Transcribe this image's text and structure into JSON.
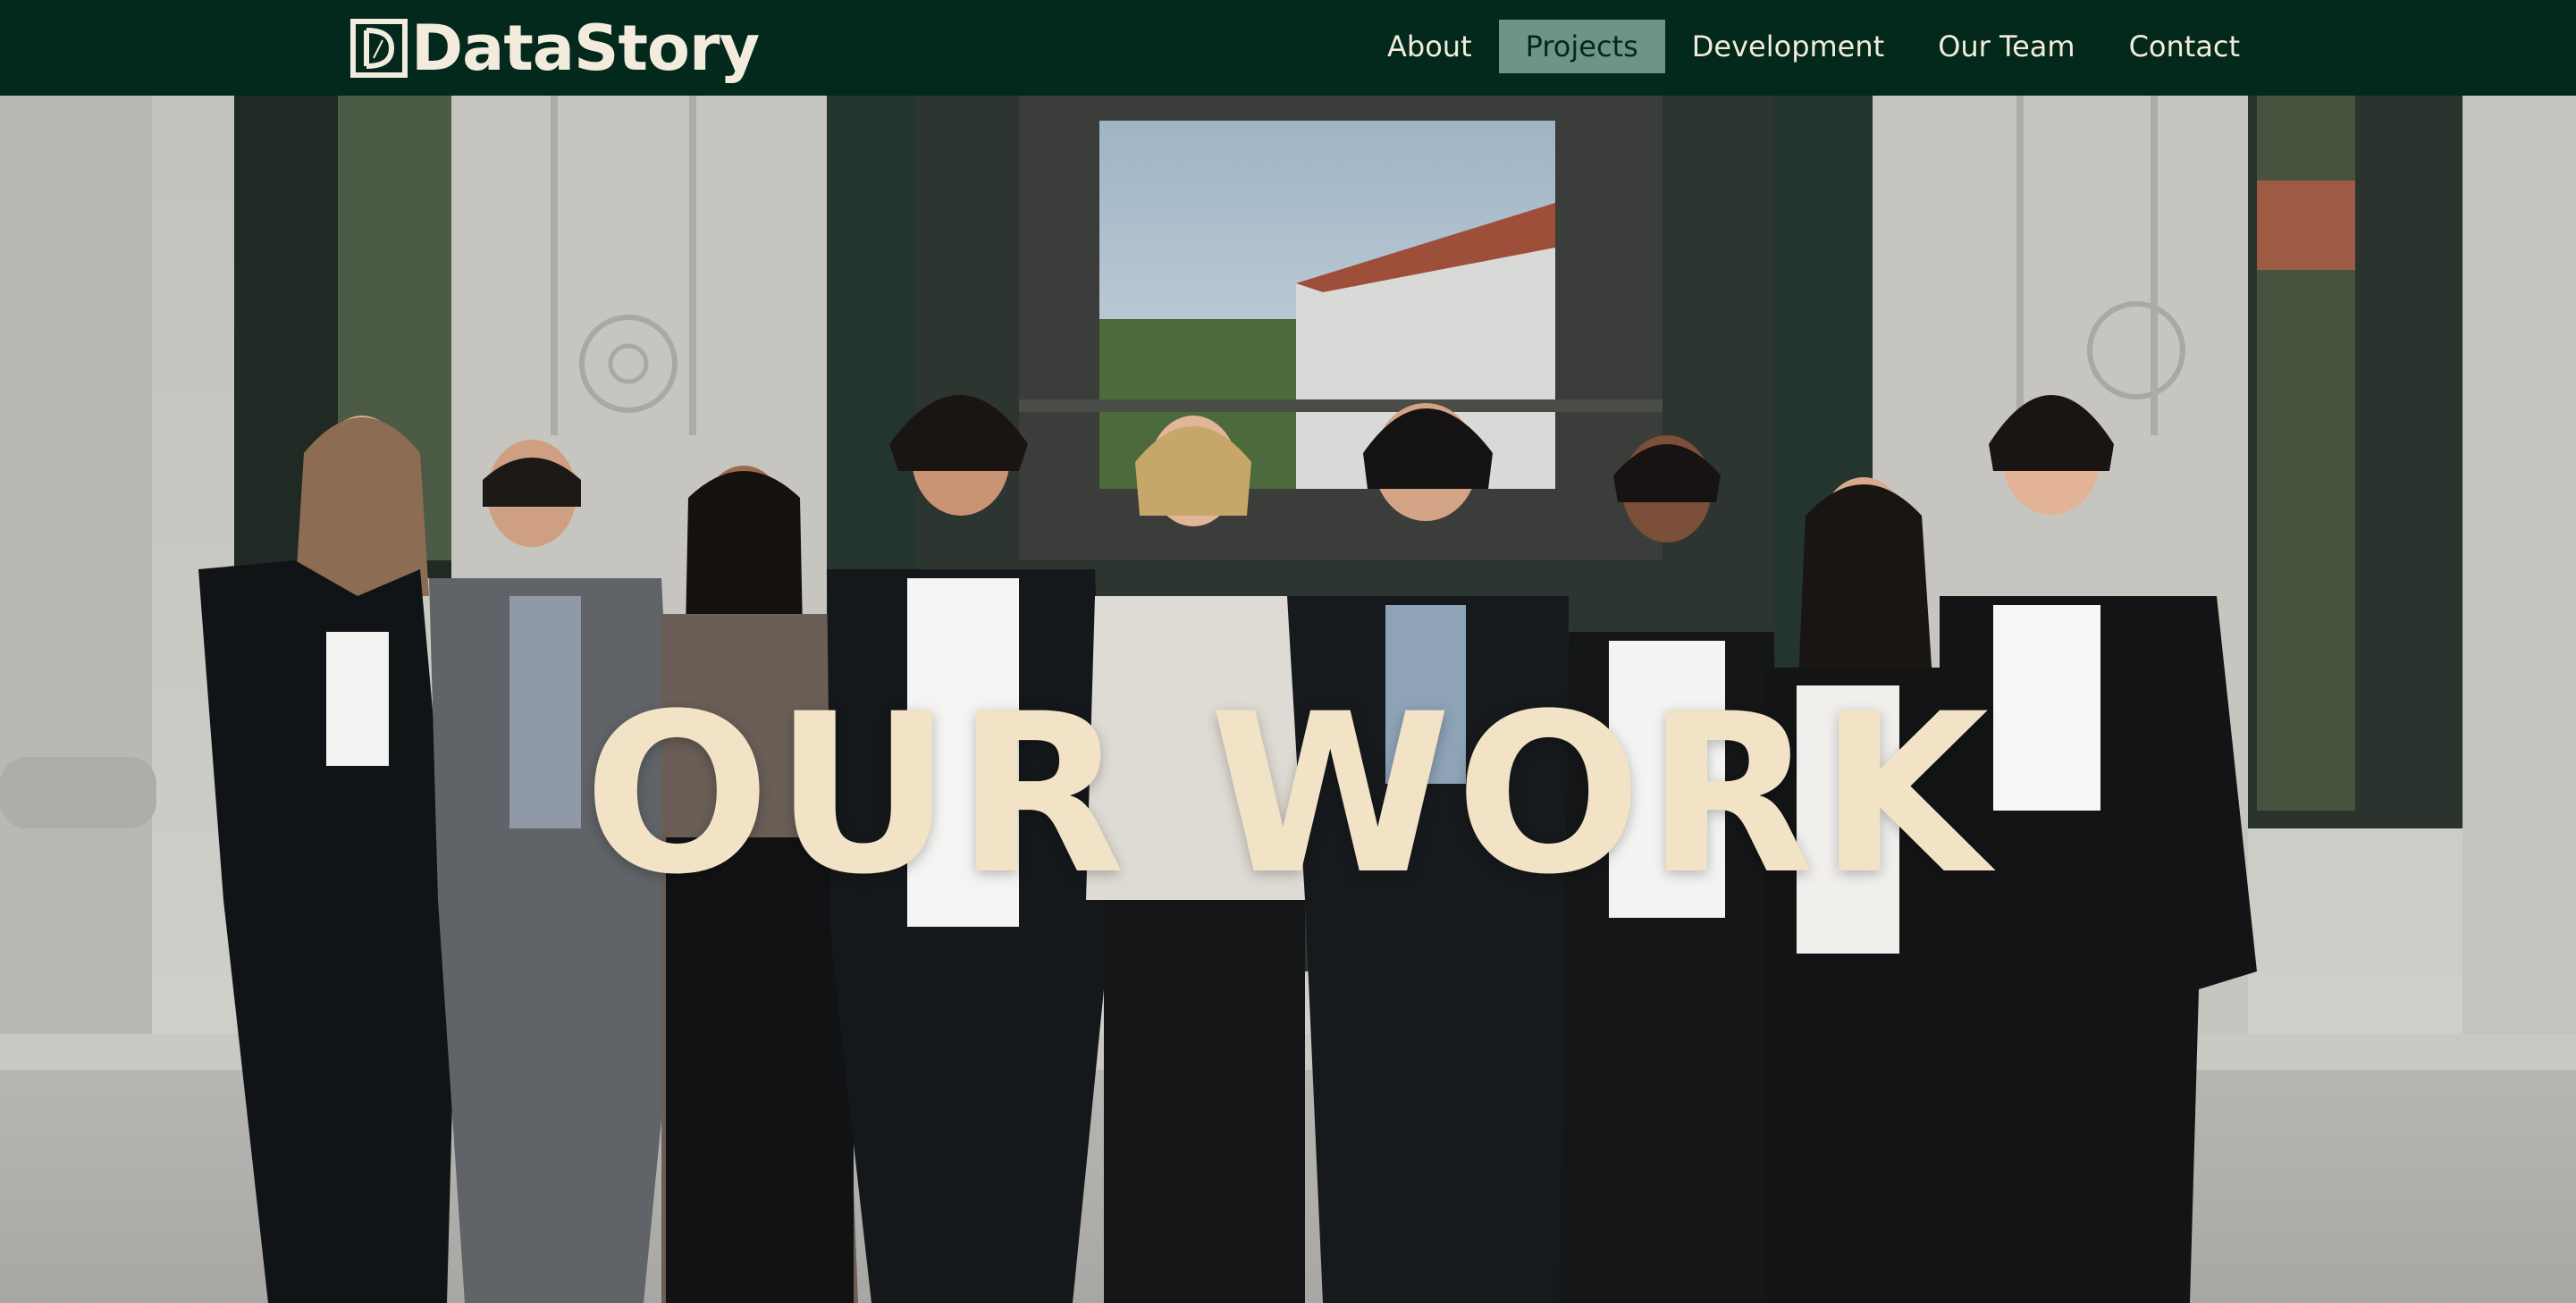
{
  "header": {
    "brand": "DataStory",
    "logo_letter": "D"
  },
  "nav": {
    "items": [
      {
        "label": "About",
        "active": false
      },
      {
        "label": "Projects",
        "active": true
      },
      {
        "label": "Development",
        "active": false
      },
      {
        "label": "Our Team",
        "active": false
      },
      {
        "label": "Contact",
        "active": false
      }
    ]
  },
  "hero": {
    "title": "OUR WORK",
    "image": "team-photo"
  },
  "colors": {
    "nav_background": "#02291b",
    "nav_text": "#f3ecdc",
    "nav_active_background": "#6e9486",
    "hero_title": "#f2e2c6"
  }
}
